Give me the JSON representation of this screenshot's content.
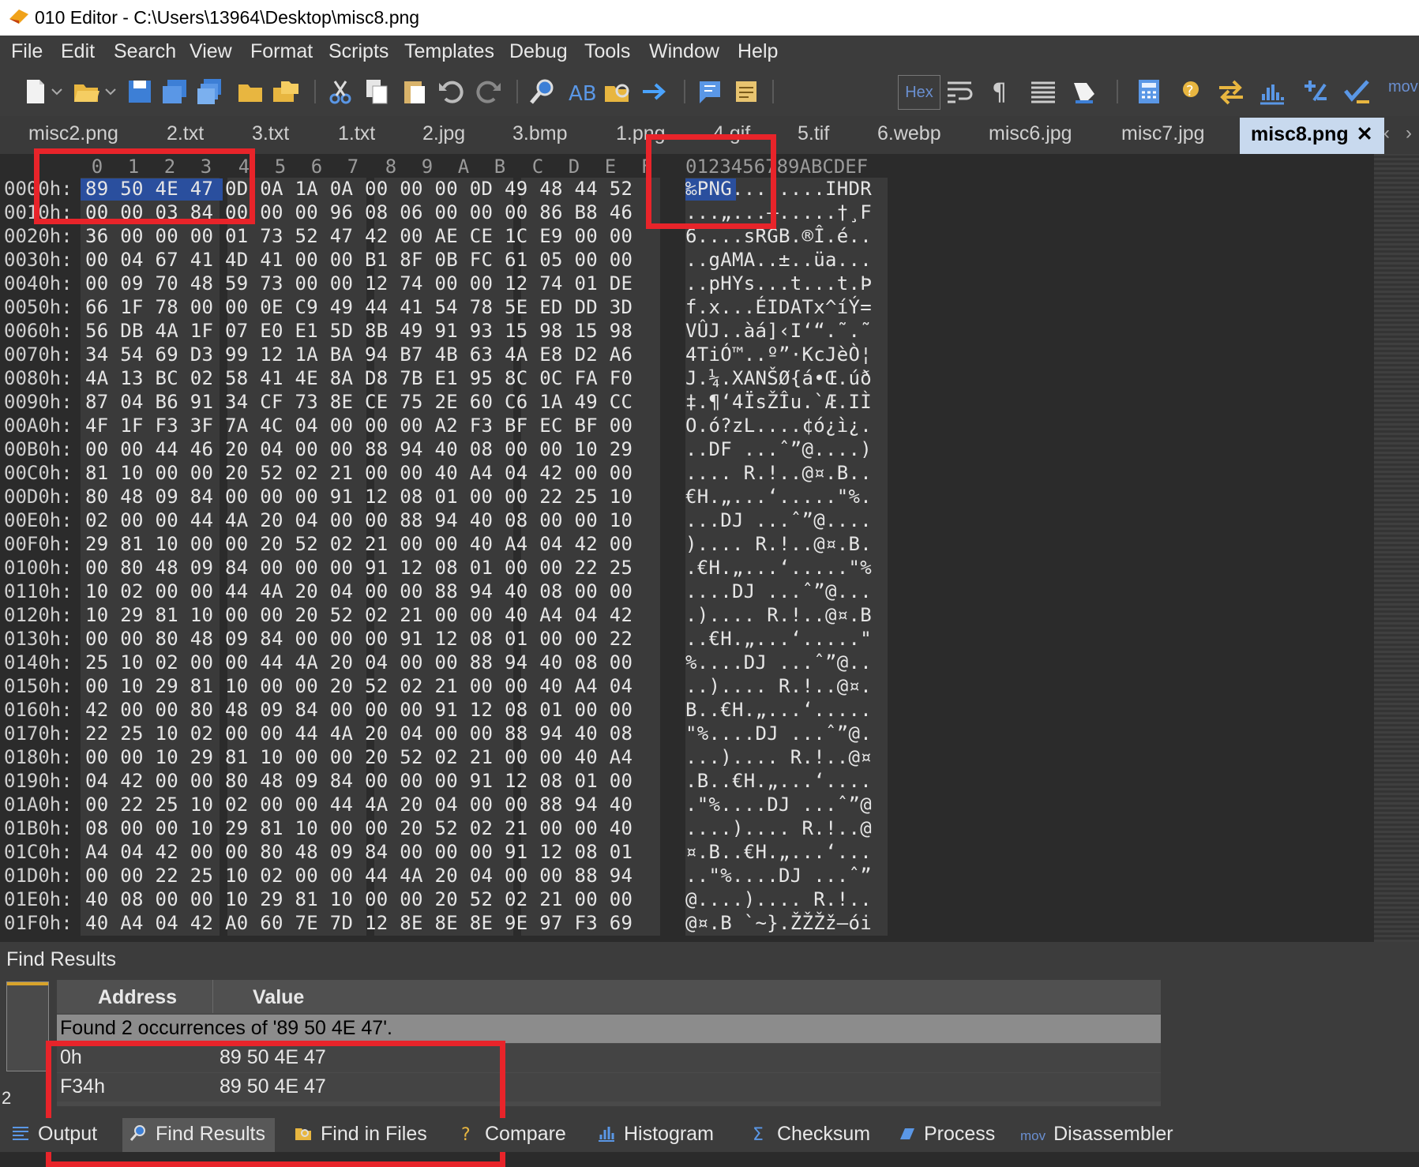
{
  "window": {
    "title": "010 Editor - C:\\Users\\13964\\Desktop\\misc8.png"
  },
  "menu": [
    "File",
    "Edit",
    "Search",
    "View",
    "Format",
    "Scripts",
    "Templates",
    "Debug",
    "Tools",
    "Window",
    "Help"
  ],
  "toolbar": {
    "hex_label": "Hex",
    "more_label": "mov"
  },
  "tabs": [
    "misc2.png",
    "2.txt",
    "3.txt",
    "1.txt",
    "2.jpg",
    "3.bmp",
    "1.png",
    "4.gif",
    "5.tif",
    "6.webp",
    "misc6.jpg",
    "misc7.jpg",
    "misc8.png"
  ],
  "active_tab_index": 12,
  "hex_view": {
    "column_headers": [
      "0",
      "1",
      "2",
      "3",
      "4",
      "5",
      "6",
      "7",
      "8",
      "9",
      "A",
      "B",
      "C",
      "D",
      "E",
      "F"
    ],
    "ascii_header": "0123456789ABCDEF",
    "rows": [
      {
        "addr": "0000h:",
        "bytes": "89 50 4E 47 0D 0A 1A 0A 00 00 00 0D 49 48 44 52",
        "ascii": "‰PNG........IHDR"
      },
      {
        "addr": "0010h:",
        "bytes": "00 00 03 84 00 00 00 96 08 06 00 00 00 86 B8 46",
        "ascii": "...„...–.....†¸F"
      },
      {
        "addr": "0020h:",
        "bytes": "36 00 00 00 01 73 52 47 42 00 AE CE 1C E9 00 00",
        "ascii": "6....sRGB.®Î.é.."
      },
      {
        "addr": "0030h:",
        "bytes": "00 04 67 41 4D 41 00 00 B1 8F 0B FC 61 05 00 00",
        "ascii": "..gAMA..±..üa..."
      },
      {
        "addr": "0040h:",
        "bytes": "00 09 70 48 59 73 00 00 12 74 00 00 12 74 01 DE",
        "ascii": "..pHYs...t...t.Þ"
      },
      {
        "addr": "0050h:",
        "bytes": "66 1F 78 00 00 0E C9 49 44 41 54 78 5E ED DD 3D",
        "ascii": "f.x...ÉIDATx^íÝ="
      },
      {
        "addr": "0060h:",
        "bytes": "56 DB 4A 1F 07 E0 E1 5D 8B 49 91 93 15 98 15 98",
        "ascii": "VÛJ..àá]‹I‘“.˜.˜"
      },
      {
        "addr": "0070h:",
        "bytes": "34 54 69 D3 99 12 1A BA 94 B7 4B 63 4A E8 D2 A6",
        "ascii": "4TiÓ™..º”·KcJèÒ¦"
      },
      {
        "addr": "0080h:",
        "bytes": "4A 13 BC 02 58 41 4E 8A D8 7B E1 95 8C 0C FA F0",
        "ascii": "J.¼.XANŠØ{á•Œ.úð"
      },
      {
        "addr": "0090h:",
        "bytes": "87 04 B6 91 34 CF 73 8E CE 75 2E 60 C6 1A 49 CC",
        "ascii": "‡.¶‘4ÏsŽÎu.`Æ.IÌ"
      },
      {
        "addr": "00A0h:",
        "bytes": "4F 1F F3 3F 7A 4C 04 00 00 00 A2 F3 BF EC BF 00",
        "ascii": "O.ó?zL....¢ó¿ì¿."
      },
      {
        "addr": "00B0h:",
        "bytes": "00 00 44 46 20 04 00 00 88 94 40 08 00 00 10 29",
        "ascii": "..DF ...ˆ”@....)"
      },
      {
        "addr": "00C0h:",
        "bytes": "81 10 00 00 20 52 02 21 00 00 40 A4 04 42 00 00",
        "ascii": ".... R.!..@¤.B.."
      },
      {
        "addr": "00D0h:",
        "bytes": "80 48 09 84 00 00 00 91 12 08 01 00 00 22 25 10",
        "ascii": "€H.„...‘.....\"%."
      },
      {
        "addr": "00E0h:",
        "bytes": "02 00 00 44 4A 20 04 00 00 88 94 40 08 00 00 10",
        "ascii": "...DJ ...ˆ”@...."
      },
      {
        "addr": "00F0h:",
        "bytes": "29 81 10 00 00 20 52 02 21 00 00 40 A4 04 42 00",
        "ascii": ").... R.!..@¤.B."
      },
      {
        "addr": "0100h:",
        "bytes": "00 80 48 09 84 00 00 00 91 12 08 01 00 00 22 25",
        "ascii": ".€H.„...‘.....\"%"
      },
      {
        "addr": "0110h:",
        "bytes": "10 02 00 00 44 4A 20 04 00 00 88 94 40 08 00 00",
        "ascii": "....DJ ...ˆ”@..."
      },
      {
        "addr": "0120h:",
        "bytes": "10 29 81 10 00 00 20 52 02 21 00 00 40 A4 04 42",
        "ascii": ".).... R.!..@¤.B"
      },
      {
        "addr": "0130h:",
        "bytes": "00 00 80 48 09 84 00 00 00 91 12 08 01 00 00 22",
        "ascii": "..€H.„...‘.....\""
      },
      {
        "addr": "0140h:",
        "bytes": "25 10 02 00 00 44 4A 20 04 00 00 88 94 40 08 00",
        "ascii": "%....DJ ...ˆ”@.."
      },
      {
        "addr": "0150h:",
        "bytes": "00 10 29 81 10 00 00 20 52 02 21 00 00 40 A4 04",
        "ascii": "..).... R.!..@¤."
      },
      {
        "addr": "0160h:",
        "bytes": "42 00 00 80 48 09 84 00 00 00 91 12 08 01 00 00",
        "ascii": "B..€H.„...‘....."
      },
      {
        "addr": "0170h:",
        "bytes": "22 25 10 02 00 00 44 4A 20 04 00 00 88 94 40 08",
        "ascii": "\"%....DJ ...ˆ”@."
      },
      {
        "addr": "0180h:",
        "bytes": "00 00 10 29 81 10 00 00 20 52 02 21 00 00 40 A4",
        "ascii": "...).... R.!..@¤"
      },
      {
        "addr": "0190h:",
        "bytes": "04 42 00 00 80 48 09 84 00 00 00 91 12 08 01 00",
        "ascii": ".B..€H.„...‘...."
      },
      {
        "addr": "01A0h:",
        "bytes": "00 22 25 10 02 00 00 44 4A 20 04 00 00 88 94 40",
        "ascii": ".\"%....DJ ...ˆ”@"
      },
      {
        "addr": "01B0h:",
        "bytes": "08 00 00 10 29 81 10 00 00 20 52 02 21 00 00 40",
        "ascii": "....).... R.!..@"
      },
      {
        "addr": "01C0h:",
        "bytes": "A4 04 42 00 00 80 48 09 84 00 00 00 91 12 08 01",
        "ascii": "¤.B..€H.„...‘..."
      },
      {
        "addr": "01D0h:",
        "bytes": "00 00 22 25 10 02 00 00 44 4A 20 04 00 00 88 94",
        "ascii": "..\"%....DJ ...ˆ”"
      },
      {
        "addr": "01E0h:",
        "bytes": "40 08 00 00 10 29 81 10 00 00 20 52 02 21 00 00",
        "ascii": "@....).... R.!.."
      },
      {
        "addr": "01F0h:",
        "bytes": "40 A4 04 42 A0 60 7E 7D 12 8E 8E 8E 9E 97 F3 69",
        "ascii": "@¤.B `~}.ŽŽŽž—ói"
      }
    ]
  },
  "find_results": {
    "panel_title": "Find Results",
    "count_label": "2",
    "columns": [
      "Address",
      "Value"
    ],
    "summary": "Found 2 occurrences of '89 50 4E 47'.",
    "results": [
      {
        "address": "0h",
        "value": "89 50 4E 47"
      },
      {
        "address": "F34h",
        "value": "89 50 4E 47"
      }
    ]
  },
  "bottom_tabs": [
    "Output",
    "Find Results",
    "Find in Files",
    "Compare",
    "Histogram",
    "Checksum",
    "Process",
    "Disassembler"
  ],
  "colors": {
    "highlight_box": "#e8242a",
    "selection": "#2a4f9e",
    "active_tab": "#c8d9ee"
  }
}
